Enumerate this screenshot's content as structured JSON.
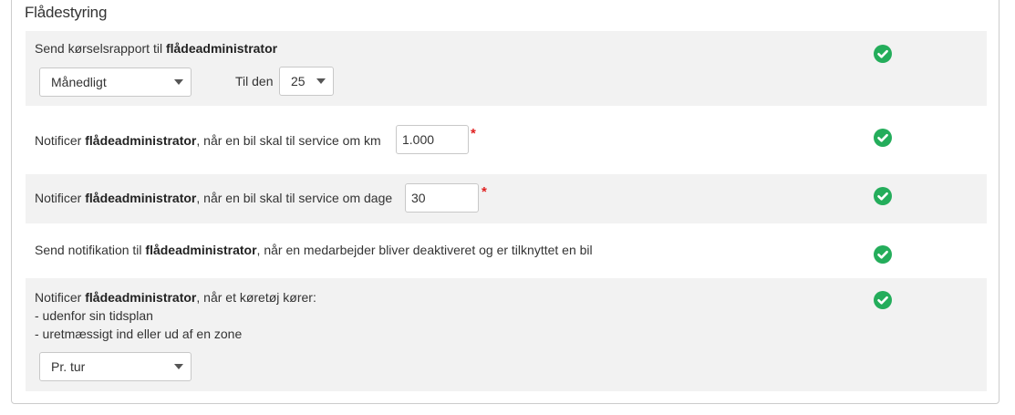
{
  "section": {
    "title": "Flådestyring"
  },
  "rows": [
    {
      "pre": "Send kørselsrapport til ",
      "bold": "flådeadministrator",
      "post": "",
      "select_value": "Månedligt",
      "til_den_label": "Til den",
      "day_value": "25"
    },
    {
      "pre": "Notificer ",
      "bold": "flådeadministrator",
      "post": ", når en bil skal til service om km",
      "input_value": "1.000",
      "required_mark": "*"
    },
    {
      "pre": "Notificer ",
      "bold": "flådeadministrator",
      "post": ", når en bil skal til service om dage",
      "input_value": "30",
      "required_mark": "*"
    },
    {
      "pre": "Send notifikation til ",
      "bold": "flådeadministrator",
      "post": ", når en medarbejder bliver deaktiveret og er tilknyttet en bil"
    },
    {
      "pre": "Notificer ",
      "bold": "flådeadministrator",
      "post": ", når et køretøj kører:",
      "line2": "- udenfor sin tidsplan",
      "line3": "- uretmæssigt ind eller ud af en zone",
      "select_value": "Pr. tur"
    }
  ],
  "icons": {
    "status": "check-circle-icon",
    "dropdown": "chevron-down-icon"
  },
  "colors": {
    "success": "#24ad5b",
    "required": "#e02020",
    "row_shade": "#f2f2f2"
  }
}
